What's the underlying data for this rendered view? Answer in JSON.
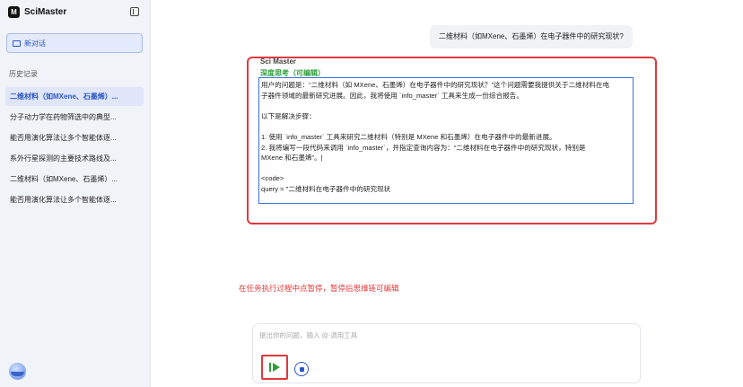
{
  "sidebar": {
    "logo_letter": "M",
    "brand": "SciMaster",
    "new_chat_label": "新对话",
    "history_title": "历史记录",
    "items": [
      {
        "label": "二维材料（如MXene、石墨烯）...",
        "active": true
      },
      {
        "label": "分子动力学在药物筛选中的典型..."
      },
      {
        "label": "能否用演化算法让多个智能体逐..."
      },
      {
        "label": "系外行星探测的主要技术路线及..."
      },
      {
        "label": "二维材料（如MXene、石墨烯）..."
      },
      {
        "label": "能否用演化算法让多个智能体逐..."
      }
    ]
  },
  "chat": {
    "user_message": "二维材料（如MXene、石墨烯）在电子器件中的研究现状?",
    "agent_name": "Sci Master",
    "thinking_label": "深度思考（可编辑）",
    "thinking_lines": [
      "用户的问题是：“二维材料（如 MXene、石墨烯）在电子器件中的研究现状？”这个问题需要我提供关于二维材料在电",
      "子器件领域的最新研究进展。因此，我将使用 `info_master` 工具来生成一份综合报告。",
      "",
      "以下是解决步骤：",
      "",
      "1. 使用 `info_master` 工具来研究二维材料（特别是 MXene 和石墨烯）在电子器件中的最新进展。",
      "2. 我将编写一段代码来调用 `info_master`，并指定查询内容为：“二维材料在电子器件中的研究现状，特别是",
      "MXene 和石墨烯”。|",
      "",
      "<code>",
      "query = \"二维材料在电子器件中的研究现状"
    ]
  },
  "annotation": "在任务执行过程中点暂停，暂停后思维链可编辑",
  "input": {
    "placeholder": "提出你的问题，输入 @ 调用工具"
  },
  "colors": {
    "accent": "#2a56c9",
    "annotation_red": "#e0393e",
    "thinking_green": "#2e9e3a"
  },
  "icons": {
    "collapse": "sidebar-collapse-icon",
    "new_chat": "chat-bubble-icon",
    "play": "resume-play-icon",
    "stop": "stop-icon"
  }
}
